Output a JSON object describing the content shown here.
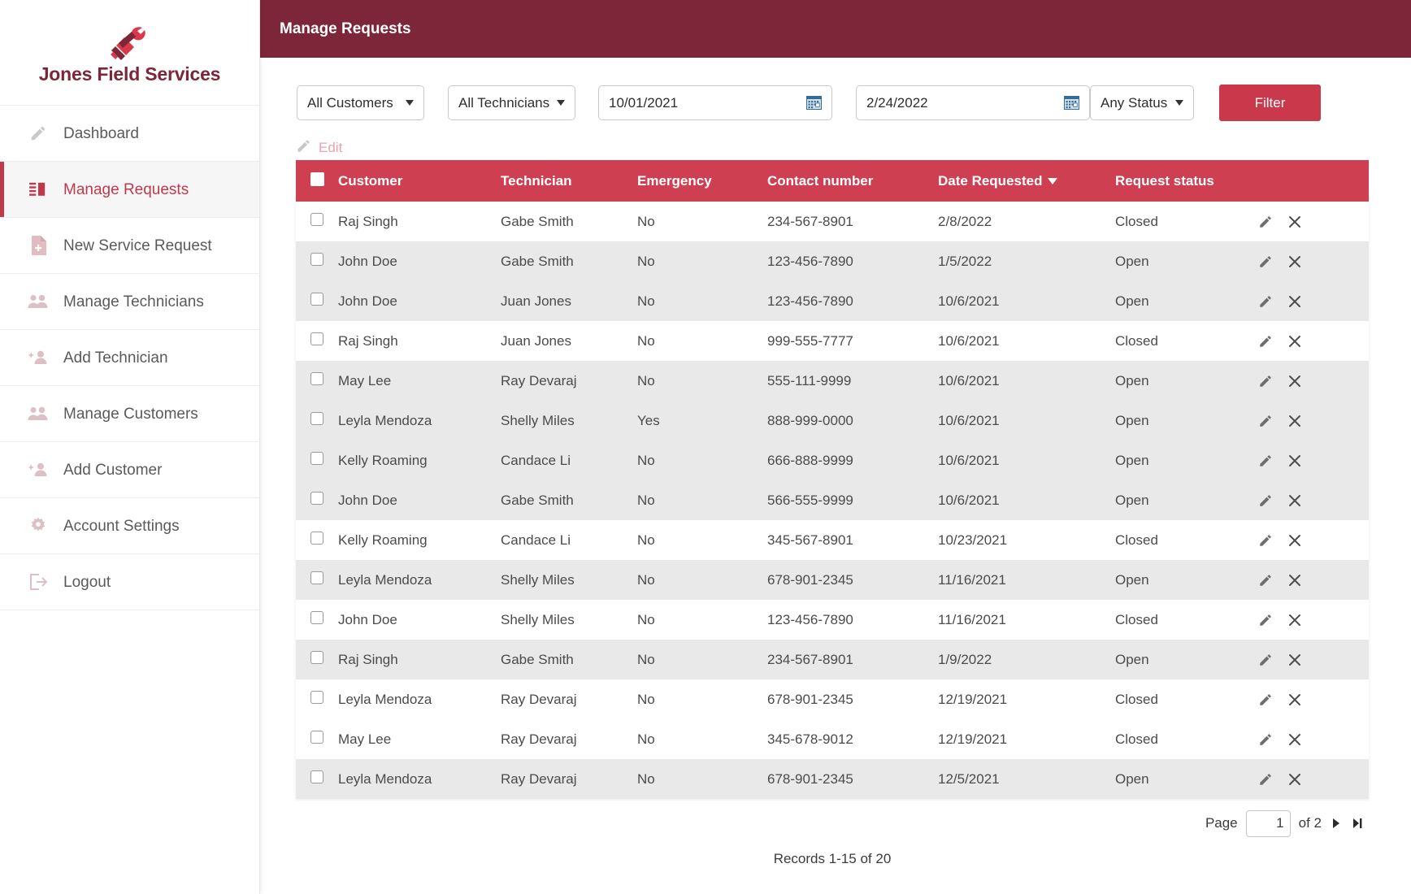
{
  "brand": {
    "title": "Jones Field Services",
    "logo_icon": "wrench-hammer-logo"
  },
  "sidebar": {
    "items": [
      {
        "label": "Dashboard",
        "icon": "pencil-icon",
        "active": false
      },
      {
        "label": "Manage Requests",
        "icon": "list-icon",
        "active": true
      },
      {
        "label": "New Service Request",
        "icon": "file-plus-icon",
        "active": false
      },
      {
        "label": "Manage Technicians",
        "icon": "people-icon",
        "active": false
      },
      {
        "label": "Add Technician",
        "icon": "person-add-icon",
        "active": false
      },
      {
        "label": "Manage Customers",
        "icon": "people-icon",
        "active": false
      },
      {
        "label": "Add Customer",
        "icon": "person-add-icon",
        "active": false
      },
      {
        "label": "Account Settings",
        "icon": "gear-icon",
        "active": false
      },
      {
        "label": "Logout",
        "icon": "logout-icon",
        "active": false
      }
    ]
  },
  "header": {
    "title": "Manage Requests",
    "bar_color": "#7d2639"
  },
  "filters": {
    "customer_select": "All Customers",
    "technician_select": "All Technicians",
    "date_from": "10/01/2021",
    "date_to": "2/24/2022",
    "status_select": "Any Status",
    "filter_button": "Filter",
    "calendar_icon": "calendar-icon",
    "chevron_icon": "chevron-down-icon"
  },
  "toolbar": {
    "edit_label": "Edit",
    "edit_icon": "pencil-icon"
  },
  "table": {
    "accent_color": "#cf3f52",
    "columns": [
      "Customer",
      "Technician",
      "Emergency",
      "Contact number",
      "Date Requested",
      "Request status"
    ],
    "sorted_column": "Date Requested",
    "sort_direction": "desc",
    "row_edit_icon": "pencil-icon",
    "row_delete_icon": "close-x-icon",
    "rows": [
      {
        "customer": "Raj Singh",
        "technician": "Gabe Smith",
        "emergency": "No",
        "contact": "234-567-8901",
        "date": "2/8/2022",
        "status": "Closed",
        "shaded": false
      },
      {
        "customer": "John Doe",
        "technician": "Gabe Smith",
        "emergency": "No",
        "contact": "123-456-7890",
        "date": "1/5/2022",
        "status": "Open",
        "shaded": true
      },
      {
        "customer": "John Doe",
        "technician": "Juan Jones",
        "emergency": "No",
        "contact": "123-456-7890",
        "date": "10/6/2021",
        "status": "Open",
        "shaded": true
      },
      {
        "customer": "Raj Singh",
        "technician": "Juan Jones",
        "emergency": "No",
        "contact": "999-555-7777",
        "date": "10/6/2021",
        "status": "Closed",
        "shaded": false
      },
      {
        "customer": "May Lee",
        "technician": "Ray Devaraj",
        "emergency": "No",
        "contact": "555-111-9999",
        "date": "10/6/2021",
        "status": "Open",
        "shaded": true
      },
      {
        "customer": "Leyla Mendoza",
        "technician": "Shelly Miles",
        "emergency": "Yes",
        "contact": "888-999-0000",
        "date": "10/6/2021",
        "status": "Open",
        "shaded": true
      },
      {
        "customer": "Kelly Roaming",
        "technician": "Candace Li",
        "emergency": "No",
        "contact": "666-888-9999",
        "date": "10/6/2021",
        "status": "Open",
        "shaded": true
      },
      {
        "customer": "John Doe",
        "technician": "Gabe Smith",
        "emergency": "No",
        "contact": "566-555-9999",
        "date": "10/6/2021",
        "status": "Open",
        "shaded": true
      },
      {
        "customer": "Kelly Roaming",
        "technician": "Candace Li",
        "emergency": "No",
        "contact": "345-567-8901",
        "date": "10/23/2021",
        "status": "Closed",
        "shaded": false
      },
      {
        "customer": "Leyla Mendoza",
        "technician": "Shelly Miles",
        "emergency": "No",
        "contact": "678-901-2345",
        "date": "11/16/2021",
        "status": "Open",
        "shaded": true
      },
      {
        "customer": "John Doe",
        "technician": "Shelly Miles",
        "emergency": "No",
        "contact": "123-456-7890",
        "date": "11/16/2021",
        "status": "Closed",
        "shaded": false
      },
      {
        "customer": "Raj Singh",
        "technician": "Gabe Smith",
        "emergency": "No",
        "contact": "234-567-8901",
        "date": "1/9/2022",
        "status": "Open",
        "shaded": true
      },
      {
        "customer": "Leyla Mendoza",
        "technician": "Ray Devaraj",
        "emergency": "No",
        "contact": "678-901-2345",
        "date": "12/19/2021",
        "status": "Closed",
        "shaded": false
      },
      {
        "customer": "May Lee",
        "technician": "Ray Devaraj",
        "emergency": "No",
        "contact": "345-678-9012",
        "date": "12/19/2021",
        "status": "Closed",
        "shaded": false
      },
      {
        "customer": "Leyla Mendoza",
        "technician": "Ray Devaraj",
        "emergency": "No",
        "contact": "678-901-2345",
        "date": "12/5/2021",
        "status": "Open",
        "shaded": true
      }
    ]
  },
  "pager": {
    "page_label": "Page",
    "page_value": "1",
    "of_label": "of 2",
    "next_icon": "next-page-icon",
    "last_icon": "last-page-icon",
    "records_label": "Records 1-15 of 20"
  }
}
